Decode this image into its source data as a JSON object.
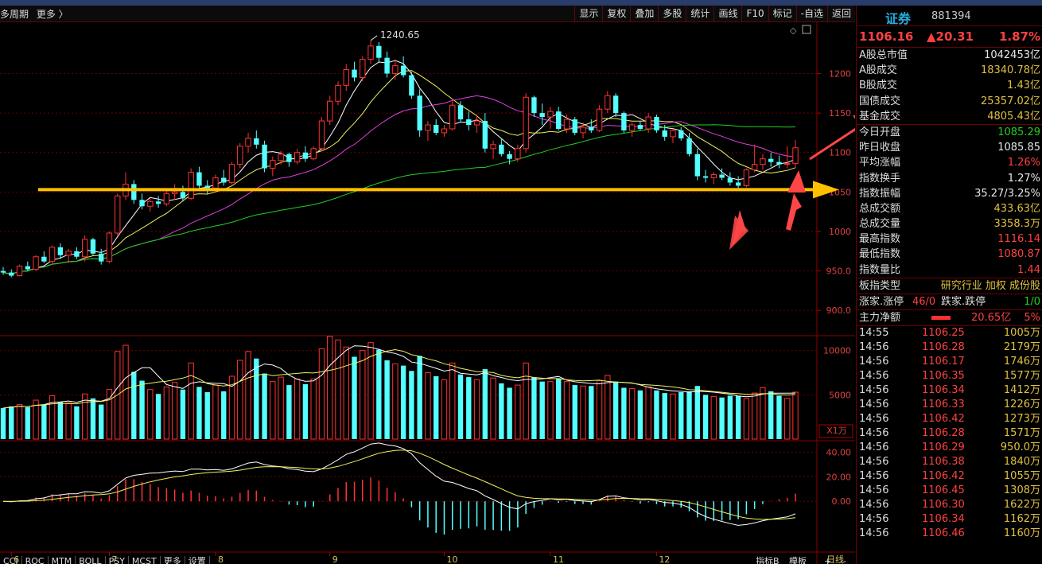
{
  "menu": {
    "left_items": [
      "多周期",
      "更多 〉"
    ],
    "toolbar": [
      "显示",
      "复权",
      "叠加",
      "多股",
      "统计",
      "画线",
      "F10",
      "标记",
      "-自选",
      "返回"
    ]
  },
  "chart": {
    "high_label": "1240.65",
    "y_price_ticks": [
      "1200",
      "1150",
      "1100",
      "1050",
      "1000",
      "950.0",
      "900.0"
    ],
    "y_vol_ticks": [
      "10000",
      "5000"
    ],
    "vol_unit": "X1万",
    "y_macd_ticks": [
      "40.00",
      "20.00",
      "0.00"
    ],
    "x_ticks": [
      "6",
      "7",
      "8",
      "9",
      "10",
      "11",
      "12"
    ],
    "period": "日线",
    "colors": {
      "up": "#ff3232",
      "down": "#54ffff",
      "ma5": "#ffffff",
      "ma10": "#f0f060",
      "ma20": "#e040e0",
      "ma60": "#20d020",
      "support_line": "#ffc000",
      "arrows": "#ff4646"
    }
  },
  "chart_data": {
    "type": "candlestick",
    "title": "",
    "price_ylim": [
      870,
      1265
    ],
    "volume_ylim": [
      0,
      11500
    ],
    "macd_ylim": [
      -40,
      48
    ],
    "support_level": 1053,
    "ohlc": [
      [
        950,
        955,
        945,
        948
      ],
      [
        948,
        952,
        942,
        944
      ],
      [
        944,
        958,
        943,
        956
      ],
      [
        956,
        962,
        950,
        952
      ],
      [
        952,
        970,
        950,
        968
      ],
      [
        968,
        975,
        960,
        962
      ],
      [
        962,
        982,
        958,
        980
      ],
      [
        980,
        985,
        965,
        970
      ],
      [
        970,
        978,
        960,
        975
      ],
      [
        975,
        980,
        965,
        968
      ],
      [
        968,
        995,
        962,
        990
      ],
      [
        990,
        992,
        970,
        972
      ],
      [
        972,
        978,
        958,
        962
      ],
      [
        962,
        1000,
        960,
        998
      ],
      [
        998,
        1048,
        995,
        1045
      ],
      [
        1045,
        1075,
        1040,
        1060
      ],
      [
        1060,
        1065,
        1035,
        1040
      ],
      [
        1040,
        1048,
        1028,
        1032
      ],
      [
        1032,
        1042,
        1025,
        1038
      ],
      [
        1038,
        1045,
        1030,
        1035
      ],
      [
        1035,
        1052,
        1032,
        1048
      ],
      [
        1048,
        1060,
        1040,
        1050
      ],
      [
        1050,
        1058,
        1038,
        1042
      ],
      [
        1042,
        1080,
        1040,
        1075
      ],
      [
        1075,
        1082,
        1055,
        1058
      ],
      [
        1058,
        1065,
        1048,
        1055
      ],
      [
        1055,
        1072,
        1050,
        1068
      ],
      [
        1068,
        1078,
        1058,
        1062
      ],
      [
        1062,
        1088,
        1060,
        1085
      ],
      [
        1085,
        1112,
        1080,
        1108
      ],
      [
        1108,
        1125,
        1100,
        1118
      ],
      [
        1118,
        1128,
        1105,
        1110
      ],
      [
        1110,
        1115,
        1075,
        1080
      ],
      [
        1080,
        1095,
        1070,
        1090
      ],
      [
        1090,
        1102,
        1085,
        1098
      ],
      [
        1098,
        1100,
        1082,
        1088
      ],
      [
        1088,
        1105,
        1085,
        1100
      ],
      [
        1100,
        1108,
        1088,
        1092
      ],
      [
        1092,
        1108,
        1090,
        1105
      ],
      [
        1105,
        1145,
        1102,
        1140
      ],
      [
        1140,
        1172,
        1135,
        1165
      ],
      [
        1165,
        1190,
        1160,
        1185
      ],
      [
        1185,
        1212,
        1178,
        1205
      ],
      [
        1205,
        1215,
        1190,
        1195
      ],
      [
        1195,
        1222,
        1190,
        1218
      ],
      [
        1218,
        1242,
        1212,
        1235
      ],
      [
        1235,
        1240,
        1215,
        1220
      ],
      [
        1220,
        1228,
        1195,
        1200
      ],
      [
        1200,
        1218,
        1192,
        1210
      ],
      [
        1210,
        1222,
        1195,
        1198
      ],
      [
        1198,
        1202,
        1168,
        1172
      ],
      [
        1172,
        1180,
        1120,
        1128
      ],
      [
        1128,
        1140,
        1115,
        1135
      ],
      [
        1135,
        1142,
        1122,
        1125
      ],
      [
        1125,
        1135,
        1120,
        1130
      ],
      [
        1130,
        1168,
        1128,
        1160
      ],
      [
        1160,
        1165,
        1138,
        1142
      ],
      [
        1142,
        1152,
        1128,
        1135
      ],
      [
        1135,
        1148,
        1125,
        1140
      ],
      [
        1140,
        1150,
        1100,
        1105
      ],
      [
        1105,
        1115,
        1092,
        1110
      ],
      [
        1110,
        1118,
        1095,
        1098
      ],
      [
        1098,
        1102,
        1085,
        1092
      ],
      [
        1092,
        1110,
        1088,
        1105
      ],
      [
        1105,
        1175,
        1100,
        1170
      ],
      [
        1170,
        1172,
        1145,
        1150
      ],
      [
        1150,
        1162,
        1135,
        1145
      ],
      [
        1145,
        1158,
        1130,
        1152
      ],
      [
        1152,
        1158,
        1128,
        1130
      ],
      [
        1130,
        1148,
        1125,
        1142
      ],
      [
        1142,
        1145,
        1122,
        1125
      ],
      [
        1125,
        1138,
        1118,
        1132
      ],
      [
        1132,
        1142,
        1125,
        1128
      ],
      [
        1128,
        1160,
        1126,
        1155
      ],
      [
        1155,
        1178,
        1150,
        1172
      ],
      [
        1172,
        1175,
        1145,
        1150
      ],
      [
        1150,
        1152,
        1125,
        1128
      ],
      [
        1128,
        1138,
        1120,
        1135
      ],
      [
        1135,
        1140,
        1128,
        1130
      ],
      [
        1130,
        1150,
        1125,
        1145
      ],
      [
        1145,
        1148,
        1125,
        1128
      ],
      [
        1128,
        1135,
        1115,
        1120
      ],
      [
        1120,
        1130,
        1112,
        1128
      ],
      [
        1128,
        1132,
        1115,
        1118
      ],
      [
        1118,
        1125,
        1095,
        1098
      ],
      [
        1098,
        1105,
        1065,
        1070
      ],
      [
        1070,
        1078,
        1062,
        1068
      ],
      [
        1068,
        1075,
        1060,
        1072
      ],
      [
        1072,
        1080,
        1065,
        1068
      ],
      [
        1068,
        1075,
        1058,
        1062
      ],
      [
        1062,
        1070,
        1055,
        1058
      ],
      [
        1058,
        1080,
        1056,
        1078
      ],
      [
        1078,
        1110,
        1075,
        1085
      ],
      [
        1085,
        1098,
        1078,
        1092
      ],
      [
        1092,
        1100,
        1082,
        1088
      ],
      [
        1088,
        1096,
        1080,
        1085
      ],
      [
        1085,
        1108,
        1080,
        1086
      ],
      [
        1086,
        1116,
        1081,
        1106
      ]
    ],
    "volume": [
      3500,
      3700,
      3900,
      3600,
      4400,
      3900,
      4900,
      4200,
      4100,
      3700,
      5100,
      4600,
      3900,
      5600,
      9900,
      10600,
      7600,
      6600,
      5600,
      5100,
      5900,
      6400,
      5600,
      8600,
      5900,
      5300,
      6100,
      5400,
      7100,
      8900,
      9900,
      9100,
      7400,
      6500,
      7000,
      6100,
      6800,
      6200,
      6800,
      10200,
      11600,
      11200,
      10400,
      9300,
      10000,
      10900,
      10100,
      8900,
      8500,
      8300,
      7700,
      9400,
      7500,
      7100,
      6700,
      8600,
      7300,
      7000,
      6700,
      7900,
      6900,
      6300,
      5800,
      6100,
      8600,
      7000,
      6500,
      6500,
      6800,
      6500,
      6100,
      6000,
      6000,
      6600,
      7200,
      6400,
      5800,
      5700,
      5500,
      5900,
      5500,
      5200,
      5100,
      5300,
      5400,
      6000,
      5000,
      4800,
      4700,
      4900,
      4900,
      4600,
      5200,
      5800,
      5400,
      4900,
      4600,
      5300
    ],
    "macd_note": "MACD panel: DIF/DEA lines with histogram bars derived from closes"
  },
  "panel": {
    "name": "证券",
    "code": "881394",
    "price": "1106.16",
    "change": "▲20.31",
    "pct": "1.87%",
    "rows1": [
      {
        "k": "A股总市值",
        "v": "1042453亿",
        "c": "#e8e8e8"
      },
      {
        "k": "A股成交",
        "v": "18340.78亿",
        "c": "#e0c040"
      },
      {
        "k": "B股成交",
        "v": "1.43亿",
        "c": "#e0c040"
      },
      {
        "k": "国债成交",
        "v": "25357.02亿",
        "c": "#e0c040"
      },
      {
        "k": "基金成交",
        "v": "4805.43亿",
        "c": "#e0c040"
      }
    ],
    "rows2": [
      {
        "k": "今日开盘",
        "v": "1085.29",
        "c": "#20d020"
      },
      {
        "k": "昨日收盘",
        "v": "1085.85",
        "c": "#e8e8e8"
      },
      {
        "k": "平均涨幅",
        "v": "1.26%",
        "c": "#ff4040"
      },
      {
        "k": "指数换手",
        "v": "1.27%",
        "c": "#e8e8e8"
      },
      {
        "k": "指数振幅",
        "v": "35.27/3.25%",
        "c": "#e8e8e8"
      },
      {
        "k": "总成交额",
        "v": "433.63亿",
        "c": "#e0c040"
      },
      {
        "k": "总成交量",
        "v": "3358.3万",
        "c": "#e0c040"
      },
      {
        "k": "最高指数",
        "v": "1116.14",
        "c": "#ff4040"
      },
      {
        "k": "最低指数",
        "v": "1080.87",
        "c": "#ff4040"
      },
      {
        "k": "指数量比",
        "v": "1.44",
        "c": "#ff4040"
      }
    ],
    "board_type_label": "板指类型",
    "board_type_value": "研究行业 加权 成份股",
    "limit": {
      "up_label": "涨家.涨停",
      "up": "46/0",
      "down_label": "跌家.跌停",
      "down": "1/0"
    },
    "main_flow": {
      "label": "主力净额",
      "value": "20.65亿",
      "pct": "5%"
    },
    "ticks": [
      {
        "t": "14:55",
        "p": "1106.25",
        "q": "1005万"
      },
      {
        "t": "14:56",
        "p": "1106.28",
        "q": "2179万"
      },
      {
        "t": "14:56",
        "p": "1106.17",
        "q": "1746万"
      },
      {
        "t": "14:56",
        "p": "1106.35",
        "q": "1577万"
      },
      {
        "t": "14:56",
        "p": "1106.34",
        "q": "1412万"
      },
      {
        "t": "14:56",
        "p": "1106.33",
        "q": "1226万"
      },
      {
        "t": "14:56",
        "p": "1106.42",
        "q": "1273万"
      },
      {
        "t": "14:56",
        "p": "1106.28",
        "q": "1571万"
      },
      {
        "t": "14:56",
        "p": "1106.29",
        "q": "950.0万"
      },
      {
        "t": "14:56",
        "p": "1106.38",
        "q": "1840万"
      },
      {
        "t": "14:56",
        "p": "1106.42",
        "q": "1055万"
      },
      {
        "t": "14:56",
        "p": "1106.45",
        "q": "1308万"
      },
      {
        "t": "14:56",
        "p": "1106.30",
        "q": "1622万"
      },
      {
        "t": "14:56",
        "p": "1106.34",
        "q": "1162万"
      },
      {
        "t": "14:56",
        "p": "1106.46",
        "q": "1160万"
      }
    ]
  },
  "bottom_tabs": [
    "CCI",
    "ROC",
    "MTM",
    "BOLL",
    "PSY",
    "MCST",
    "更多",
    "设置"
  ],
  "bottom_right": [
    "指标B",
    "模板",
    "+",
    "-"
  ]
}
